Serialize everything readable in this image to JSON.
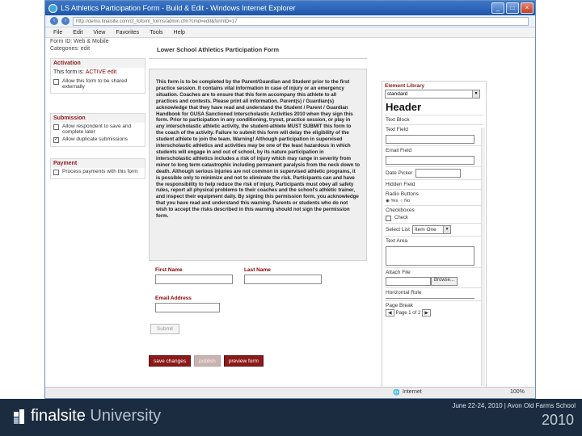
{
  "window": {
    "title": "LS Athletics Participation Form - Build & Edit - Windows Internet Explorer",
    "url": "http://demo.finalsite.com/cf_foform_forms/admin.cfm?cmd=edit&formID=17"
  },
  "menu": [
    "File",
    "Edit",
    "View",
    "Favorites",
    "Tools",
    "Help"
  ],
  "sidebar": {
    "top_lines": [
      "Form ID: Web & Mobile",
      "Categories: edit"
    ],
    "activation": {
      "heading": "Activation",
      "status_prefix": "This form is:",
      "status_value": "ACTIVE",
      "status_link": "edit",
      "check_label": "Allow this form to be shared externally"
    },
    "submission": {
      "heading": "Submission",
      "checks": [
        {
          "label": "Allow respondent to save and complete later",
          "checked": false
        },
        {
          "label": "Allow duplicate submissions",
          "checked": true
        }
      ]
    },
    "payment": {
      "heading": "Payment",
      "checks": [
        {
          "label": "Process payments with this form",
          "checked": false
        }
      ]
    }
  },
  "form": {
    "title": "Lower School Athletics Participation Form",
    "body": "This form is to be completed by the Parent/Guardian and Student prior to the first practice session. It contains vital information in case of injury or an emergency situation. Coaches are to ensure that this form accompany this athlete to all practices and contests. Please print all information. Parent(s) / Guardian(s) acknowledge that they have read and understand the Student / Parent / Guardian Handbook for GUSA Sanctioned Interscholastic Activities 2010 when they sign this form. Prior to participation in any conditioning, tryout, practice session, or play in any interscholastic athletic activity, the student-athlete MUST SUBMIT this form to the coach of the activity. Failure to submit this form will delay the eligibility of the student athlete to join the team. Warning! Although participation in supervised interscholastic athletics and activities may be one of the least hazardous in which students will engage in and out of school, by its nature participation in interscholastic athletics includes a risk of injury which may range in severity from minor to long term catastrophic including permanent paralysis from the neck down to death. Although serious injuries are not common in supervised athletic programs, it is possible only to minimize and not to eliminate the risk. Participants can and have the responsibility to help reduce the risk of injury. Participants must obey all safety rules, report all physical problems to their coaches and the school's athletic trainer, and inspect their equipment daily. By signing this permission form, you acknowledge that you have read and understand this warning. Parents or students who do not wish to accept the risks described in this warning should not sign the permission form.",
    "first_name_label": "First Name",
    "last_name_label": "Last Name",
    "email_label": "Email Address",
    "submit_label": "Submit"
  },
  "actions": {
    "save": "save changes",
    "publish": "publish",
    "preview": "preview form"
  },
  "library": {
    "heading": "Element Library",
    "selected": "standard",
    "header_item": "Header",
    "items": {
      "text_block": "Text Block",
      "text_field": "Text Field",
      "email_field": "Email Field",
      "date_picker": "Date Picker",
      "hidden_field": "Hidden Field",
      "radio_buttons": "Radio Buttons",
      "radio_yes": "Yes",
      "radio_no": "No",
      "checkboxes": "Checkboxes",
      "check": "Check",
      "select_list": "Select List",
      "select_value": "Item One",
      "text_area": "Text Area",
      "attach_file": "Attach File",
      "browse": "Browse...",
      "horizontal_rule": "Horizontal Rule",
      "page_break": "Page Break",
      "page_of": "Page 1 of 2"
    }
  },
  "statusbar": {
    "zone": "Internet",
    "zoom": "100%"
  },
  "footer": {
    "brand": "finalsite",
    "brand_suffix": "University",
    "event": "June 22-24, 2010 | Avon Old Farms School",
    "year": "2010"
  },
  "colors": {
    "accent": "#8b1a1a",
    "banner": "#1b2c40"
  }
}
